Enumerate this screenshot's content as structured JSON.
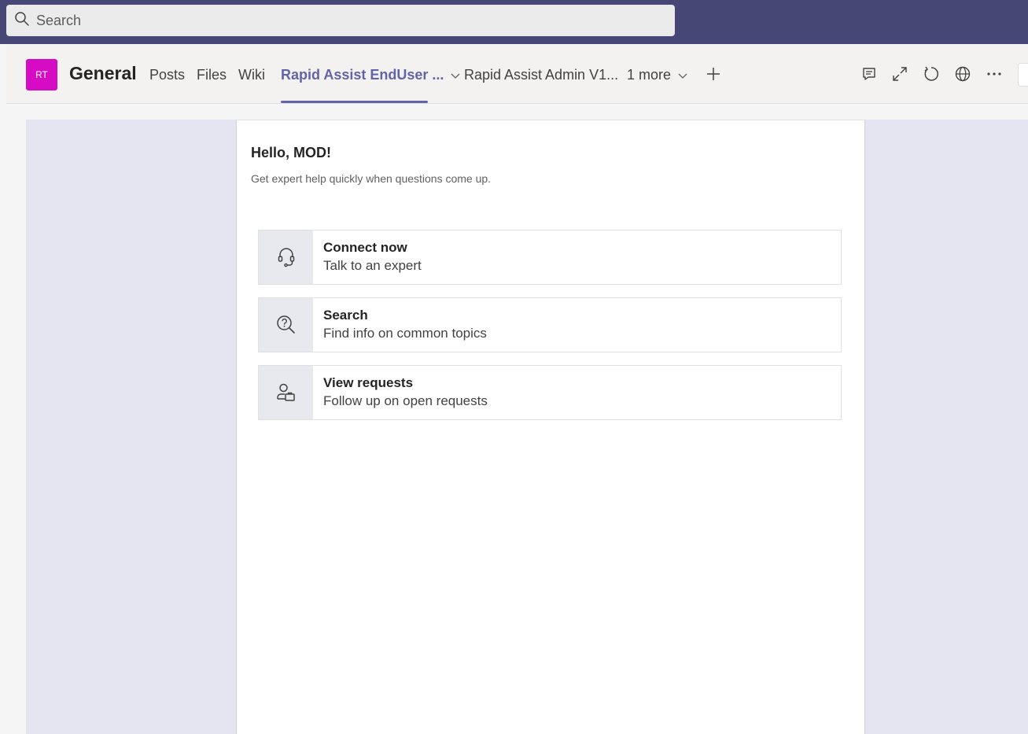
{
  "search": {
    "placeholder": "Search",
    "icon": "search-icon"
  },
  "header": {
    "team_initials": "RT",
    "team_color": "#d60cc4",
    "channel_name": "General",
    "tabs": [
      {
        "label": "Posts"
      },
      {
        "label": "Files"
      },
      {
        "label": "Wiki"
      },
      {
        "label": "Rapid Assist EndUser ...",
        "active": true
      },
      {
        "label": "Rapid Assist Admin V1..."
      },
      {
        "label": "1 more"
      }
    ],
    "accent_color": "#6264a7",
    "icons": [
      "conversation-icon",
      "expand-icon",
      "refresh-icon",
      "globe-icon",
      "more-options-icon"
    ]
  },
  "main": {
    "greeting": "Hello, MOD!",
    "subtitle": "Get expert help quickly when questions come up.",
    "options": [
      {
        "title": "Connect now",
        "description": "Talk to an expert",
        "icon": "headset-icon"
      },
      {
        "title": "Search",
        "description": "Find info on common topics",
        "icon": "search-question-icon"
      },
      {
        "title": "View requests",
        "description": "Follow up on open requests",
        "icon": "person-briefcase-icon"
      }
    ]
  }
}
